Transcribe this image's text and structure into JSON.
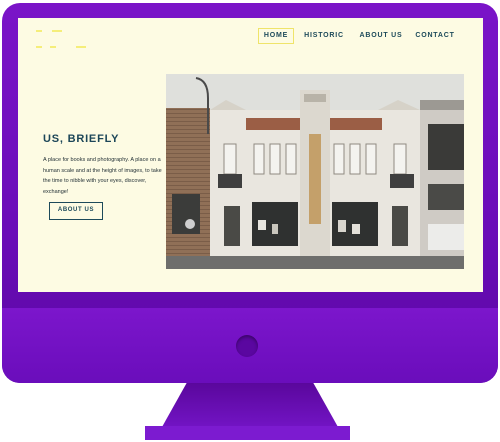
{
  "nav": {
    "items": [
      {
        "label": "HOME"
      },
      {
        "label": "HISTORIC"
      },
      {
        "label": "ABOUT US"
      },
      {
        "label": "CONTACT"
      }
    ]
  },
  "intro": {
    "heading": "US, BRIEFLY",
    "text": "A place for books and photography. A place on a human scale and at the height of images, to take the time to nibble with your eyes, discover, exchange!",
    "button_label": "ABOUT US"
  },
  "colors": {
    "frame": "#6a0cb8",
    "screen_bg": "#fdfbe3",
    "heading": "#1c4658",
    "accent": "#efe46a"
  }
}
